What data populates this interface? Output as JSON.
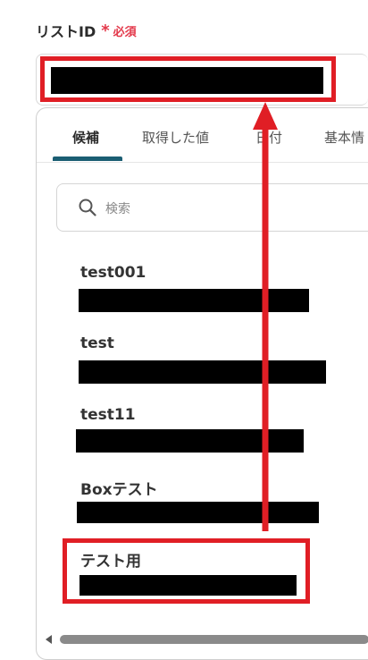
{
  "field": {
    "label": "リストID",
    "required_mark": "*",
    "required_text": "必須"
  },
  "tabs": [
    {
      "label": "候補"
    },
    {
      "label": "取得した値"
    },
    {
      "label": "日付"
    },
    {
      "label": "基本情"
    }
  ],
  "search": {
    "placeholder": "検索"
  },
  "options": [
    {
      "label": "test001"
    },
    {
      "label": "test"
    },
    {
      "label": "test11"
    },
    {
      "label": "Boxテスト"
    },
    {
      "label": "テスト用"
    }
  ],
  "colors": {
    "highlight": "#e01e25",
    "required": "#e3384a",
    "tab_underline": "#1b5e73"
  }
}
